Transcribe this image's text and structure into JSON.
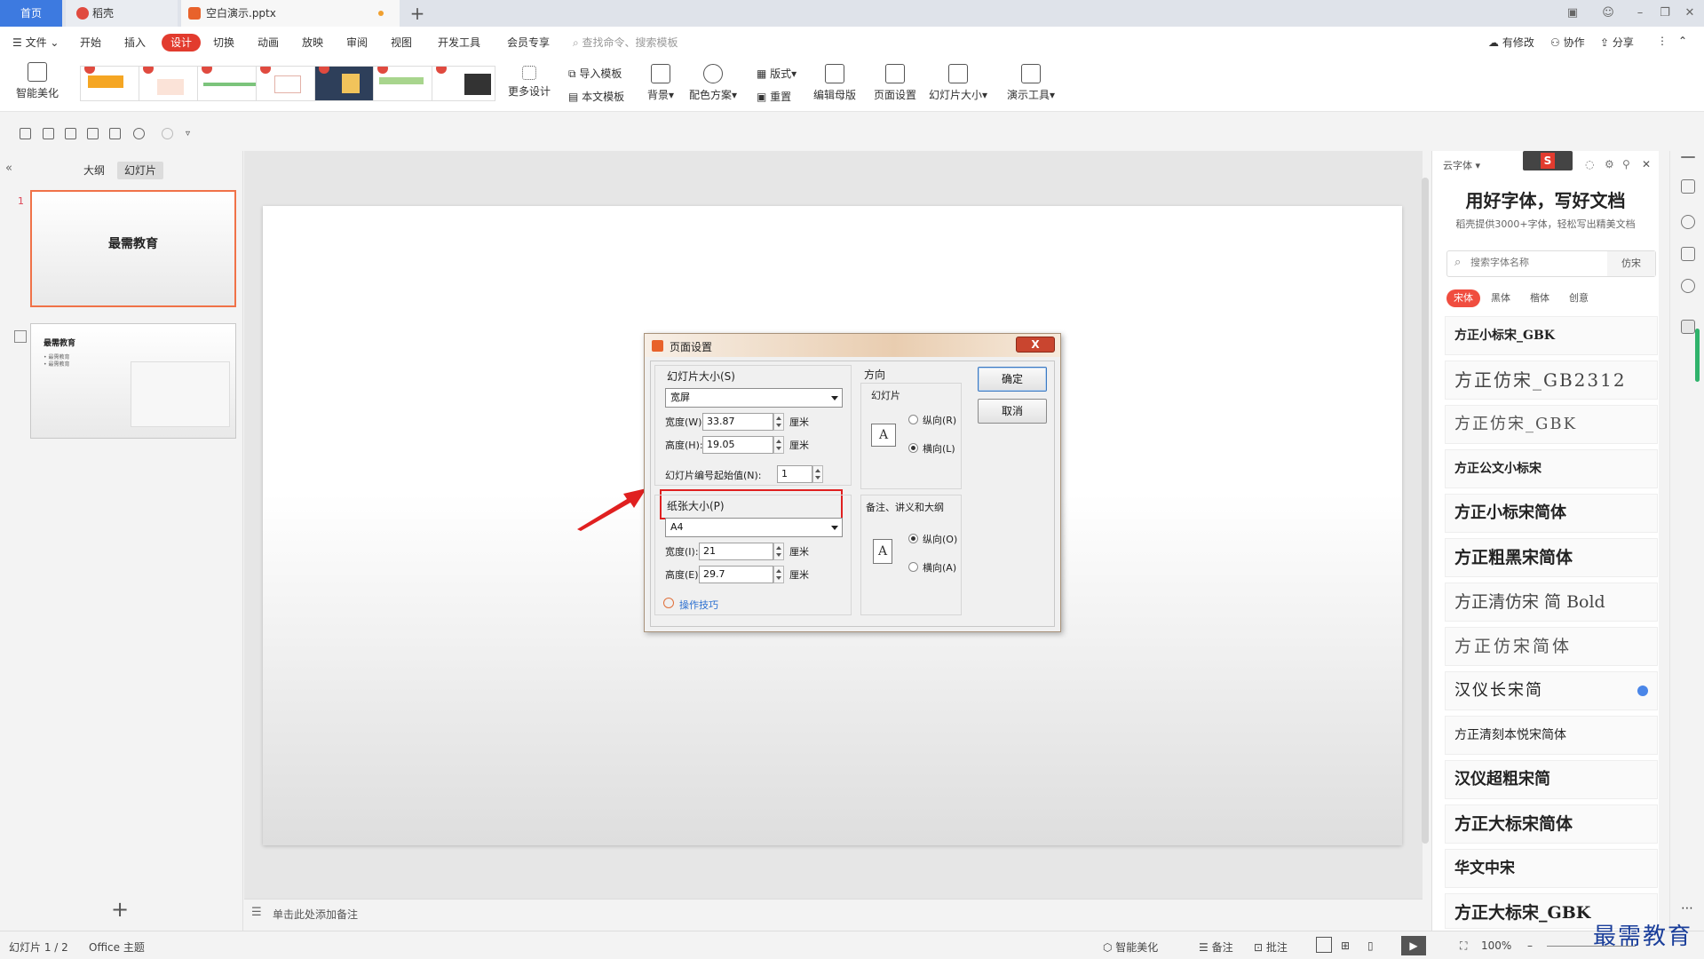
{
  "tabs": {
    "home": "首页",
    "daoke": "稻壳",
    "file": "空白演示.pptx",
    "new_tab": "+"
  },
  "menu": {
    "file": "文件",
    "items": [
      "开始",
      "插入",
      "设计",
      "切换",
      "动画",
      "放映",
      "审阅",
      "视图",
      "开发工具",
      "会员专享"
    ],
    "search": "查找命令、搜索模板",
    "right": [
      "有修改",
      "协作",
      "分享"
    ]
  },
  "ribbon": {
    "smart_beautify": "智能美化",
    "more_design": "更多设计",
    "import_template": "导入模板",
    "this_template": "本文模板",
    "background": "背景",
    "color_scheme": "配色方案",
    "layout": "版式",
    "reset": "重置",
    "edit_master": "编辑母版",
    "page_setup": "页面设置",
    "slide_size": "幻灯片大小",
    "present_tools": "演示工具"
  },
  "left_panel": {
    "tab_outline": "大纲",
    "tab_slides": "幻灯片",
    "slide1_num": "1",
    "slide1_title": "最需教育",
    "slide2_title": "最需教育",
    "slide2_bullets": [
      "• 最需教育",
      "• 最需教育"
    ]
  },
  "notes": {
    "placeholder": "单击此处添加备注"
  },
  "status": {
    "slide_count": "幻灯片 1 / 2",
    "theme": "Office 主题",
    "smart_beautify": "智能美化",
    "notes": "备注",
    "comments": "批注",
    "zoom": "100%"
  },
  "right_panel": {
    "header": "云字体",
    "logo": "S",
    "title": "用好字体，写好文档",
    "subtitle": "稻壳提供3000+字体，轻松写出精美文档",
    "search_placeholder": "搜索字体名称",
    "search_btn": "仿宋",
    "categories": [
      "宋体",
      "黑体",
      "楷体",
      "创意"
    ],
    "fonts": [
      "方正小标宋_GBK",
      "方正仿宋_GB2312",
      "方正仿宋_GBK",
      "方正公文小标宋",
      "方正小标宋简体",
      "方正粗黑宋简体",
      "方正清仿宋 简 Bold",
      "方正仿宋简体",
      "汉仪长宋简",
      "方正清刻本悦宋简体",
      "汉仪超粗宋简",
      "方正大标宋简体",
      "华文中宋",
      "方正大标宋_GBK"
    ]
  },
  "dialog": {
    "title": "页面设置",
    "close": "X",
    "slide_size_label": "幻灯片大小(S)",
    "slide_size_value": "宽屏",
    "width_label": "宽度(W):",
    "width_value": "33.87",
    "height_label": "高度(H):",
    "height_value": "19.05",
    "unit": "厘米",
    "start_num_label": "幻灯片编号起始值(N):",
    "start_num_value": "1",
    "paper_size_label": "纸张大小(P)",
    "paper_size_value": "A4",
    "paper_width_label": "宽度(I):",
    "paper_width_value": "21",
    "paper_height_label": "高度(E):",
    "paper_height_value": "29.7",
    "orientation_label": "方向",
    "slides_label": "幻灯片",
    "portrait_r": "纵向(R)",
    "landscape_l": "横向(L)",
    "notes_label": "备注、讲义和大纲",
    "portrait_o": "纵向(O)",
    "landscape_a": "横向(A)",
    "ok": "确定",
    "cancel": "取消",
    "tips": "操作技巧",
    "icon_letter": "A"
  },
  "watermark": "最需教育",
  "colors": {
    "accent": "#e23b2e",
    "highlight": "#e02020",
    "home_tab": "#3d7ae0"
  }
}
